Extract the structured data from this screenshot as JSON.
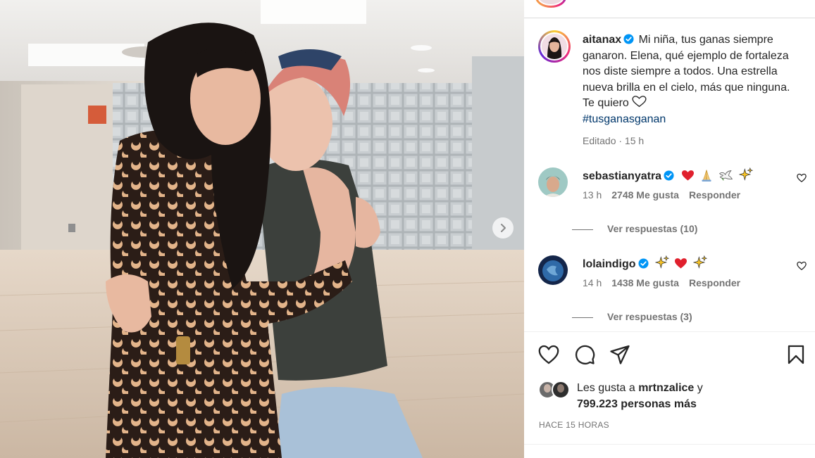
{
  "post": {
    "author": "aitanax",
    "caption_text": "Mi niña, tus ganas siempre ganaron. Elena, qué ejemplo de fortaleza nos diste siempre a todos. Una estrella nueva brilla en el cielo, más que ninguna. Te quiero",
    "hashtag": "#tusganasganan",
    "edited_meta": "Editado · 15 h"
  },
  "comments": [
    {
      "username": "sebastianyatra",
      "emojis": [
        "red-heart",
        "folded-hands",
        "dove",
        "sparkles"
      ],
      "time": "13 h",
      "likes": "2748 Me gusta",
      "reply_label": "Responder",
      "view_replies": "Ver respuestas (10)"
    },
    {
      "username": "lolaindigo",
      "emojis": [
        "sparkles",
        "red-heart",
        "sparkles"
      ],
      "time": "14 h",
      "likes": "1438 Me gusta",
      "reply_label": "Responder",
      "view_replies": "Ver respuestas (3)"
    }
  ],
  "likes": {
    "prefix": "Les gusta a",
    "user": "mrtnzalice",
    "suffix": "y",
    "others": "799.223 personas más"
  },
  "time_ago": "HACE 15 HORAS",
  "colors": {
    "accent_link": "#00376b",
    "verified": "#0095f6",
    "muted": "#737373",
    "text": "#262626"
  },
  "icons": {
    "carousel_next": "chevron-right-icon",
    "like": "heart-outline-icon",
    "comment": "comment-bubble-icon",
    "share": "paper-plane-icon",
    "save": "bookmark-icon"
  }
}
